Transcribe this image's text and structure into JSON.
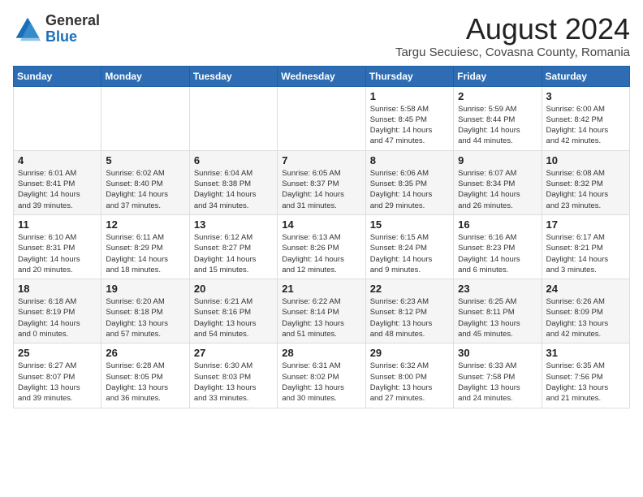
{
  "logo": {
    "general": "General",
    "blue": "Blue"
  },
  "title": "August 2024",
  "location": "Targu Secuiesc, Covasna County, Romania",
  "days_of_week": [
    "Sunday",
    "Monday",
    "Tuesday",
    "Wednesday",
    "Thursday",
    "Friday",
    "Saturday"
  ],
  "weeks": [
    [
      {
        "day": "",
        "info": ""
      },
      {
        "day": "",
        "info": ""
      },
      {
        "day": "",
        "info": ""
      },
      {
        "day": "",
        "info": ""
      },
      {
        "day": "1",
        "info": "Sunrise: 5:58 AM\nSunset: 8:45 PM\nDaylight: 14 hours\nand 47 minutes."
      },
      {
        "day": "2",
        "info": "Sunrise: 5:59 AM\nSunset: 8:44 PM\nDaylight: 14 hours\nand 44 minutes."
      },
      {
        "day": "3",
        "info": "Sunrise: 6:00 AM\nSunset: 8:42 PM\nDaylight: 14 hours\nand 42 minutes."
      }
    ],
    [
      {
        "day": "4",
        "info": "Sunrise: 6:01 AM\nSunset: 8:41 PM\nDaylight: 14 hours\nand 39 minutes."
      },
      {
        "day": "5",
        "info": "Sunrise: 6:02 AM\nSunset: 8:40 PM\nDaylight: 14 hours\nand 37 minutes."
      },
      {
        "day": "6",
        "info": "Sunrise: 6:04 AM\nSunset: 8:38 PM\nDaylight: 14 hours\nand 34 minutes."
      },
      {
        "day": "7",
        "info": "Sunrise: 6:05 AM\nSunset: 8:37 PM\nDaylight: 14 hours\nand 31 minutes."
      },
      {
        "day": "8",
        "info": "Sunrise: 6:06 AM\nSunset: 8:35 PM\nDaylight: 14 hours\nand 29 minutes."
      },
      {
        "day": "9",
        "info": "Sunrise: 6:07 AM\nSunset: 8:34 PM\nDaylight: 14 hours\nand 26 minutes."
      },
      {
        "day": "10",
        "info": "Sunrise: 6:08 AM\nSunset: 8:32 PM\nDaylight: 14 hours\nand 23 minutes."
      }
    ],
    [
      {
        "day": "11",
        "info": "Sunrise: 6:10 AM\nSunset: 8:31 PM\nDaylight: 14 hours\nand 20 minutes."
      },
      {
        "day": "12",
        "info": "Sunrise: 6:11 AM\nSunset: 8:29 PM\nDaylight: 14 hours\nand 18 minutes."
      },
      {
        "day": "13",
        "info": "Sunrise: 6:12 AM\nSunset: 8:27 PM\nDaylight: 14 hours\nand 15 minutes."
      },
      {
        "day": "14",
        "info": "Sunrise: 6:13 AM\nSunset: 8:26 PM\nDaylight: 14 hours\nand 12 minutes."
      },
      {
        "day": "15",
        "info": "Sunrise: 6:15 AM\nSunset: 8:24 PM\nDaylight: 14 hours\nand 9 minutes."
      },
      {
        "day": "16",
        "info": "Sunrise: 6:16 AM\nSunset: 8:23 PM\nDaylight: 14 hours\nand 6 minutes."
      },
      {
        "day": "17",
        "info": "Sunrise: 6:17 AM\nSunset: 8:21 PM\nDaylight: 14 hours\nand 3 minutes."
      }
    ],
    [
      {
        "day": "18",
        "info": "Sunrise: 6:18 AM\nSunset: 8:19 PM\nDaylight: 14 hours\nand 0 minutes."
      },
      {
        "day": "19",
        "info": "Sunrise: 6:20 AM\nSunset: 8:18 PM\nDaylight: 13 hours\nand 57 minutes."
      },
      {
        "day": "20",
        "info": "Sunrise: 6:21 AM\nSunset: 8:16 PM\nDaylight: 13 hours\nand 54 minutes."
      },
      {
        "day": "21",
        "info": "Sunrise: 6:22 AM\nSunset: 8:14 PM\nDaylight: 13 hours\nand 51 minutes."
      },
      {
        "day": "22",
        "info": "Sunrise: 6:23 AM\nSunset: 8:12 PM\nDaylight: 13 hours\nand 48 minutes."
      },
      {
        "day": "23",
        "info": "Sunrise: 6:25 AM\nSunset: 8:11 PM\nDaylight: 13 hours\nand 45 minutes."
      },
      {
        "day": "24",
        "info": "Sunrise: 6:26 AM\nSunset: 8:09 PM\nDaylight: 13 hours\nand 42 minutes."
      }
    ],
    [
      {
        "day": "25",
        "info": "Sunrise: 6:27 AM\nSunset: 8:07 PM\nDaylight: 13 hours\nand 39 minutes."
      },
      {
        "day": "26",
        "info": "Sunrise: 6:28 AM\nSunset: 8:05 PM\nDaylight: 13 hours\nand 36 minutes."
      },
      {
        "day": "27",
        "info": "Sunrise: 6:30 AM\nSunset: 8:03 PM\nDaylight: 13 hours\nand 33 minutes."
      },
      {
        "day": "28",
        "info": "Sunrise: 6:31 AM\nSunset: 8:02 PM\nDaylight: 13 hours\nand 30 minutes."
      },
      {
        "day": "29",
        "info": "Sunrise: 6:32 AM\nSunset: 8:00 PM\nDaylight: 13 hours\nand 27 minutes."
      },
      {
        "day": "30",
        "info": "Sunrise: 6:33 AM\nSunset: 7:58 PM\nDaylight: 13 hours\nand 24 minutes."
      },
      {
        "day": "31",
        "info": "Sunrise: 6:35 AM\nSunset: 7:56 PM\nDaylight: 13 hours\nand 21 minutes."
      }
    ]
  ]
}
